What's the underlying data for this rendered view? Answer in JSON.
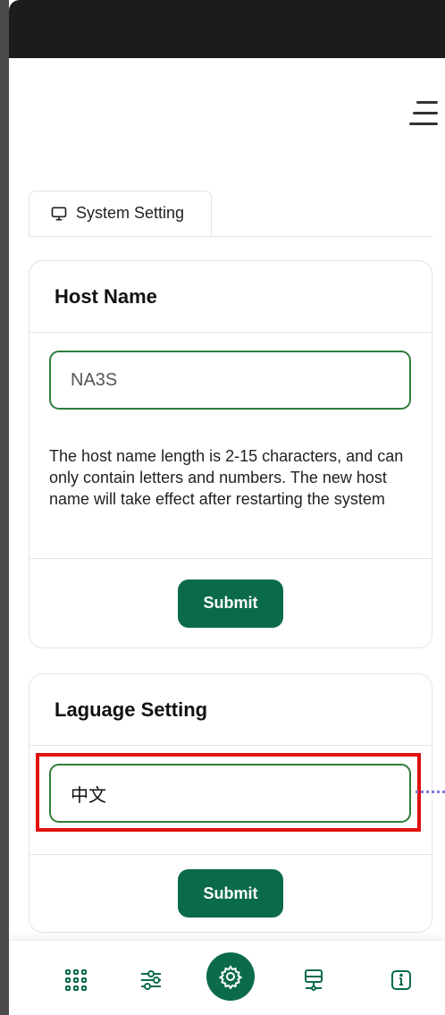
{
  "tabs": [
    {
      "label": "System Setting",
      "icon": "monitor-icon"
    }
  ],
  "host_name_card": {
    "title": "Host Name",
    "input_value": "NA3S",
    "help_text": "The host name length is 2-15 characters, and can only contain letters and numbers. The new host name will take effect after restarting the system",
    "submit_label": "Submit"
  },
  "language_card": {
    "title": "Laguage Setting",
    "selected_value": "中文",
    "submit_label": "Submit"
  },
  "bottom_nav": [
    {
      "icon": "grid-icon",
      "active": false
    },
    {
      "icon": "sliders-icon",
      "active": false
    },
    {
      "icon": "gear-icon",
      "active": true
    },
    {
      "icon": "network-icon",
      "active": false
    },
    {
      "icon": "info-icon",
      "active": false
    }
  ],
  "colors": {
    "accent": "#0b6b48",
    "input_border": "#2e7d3a",
    "highlight": "#e01010"
  }
}
